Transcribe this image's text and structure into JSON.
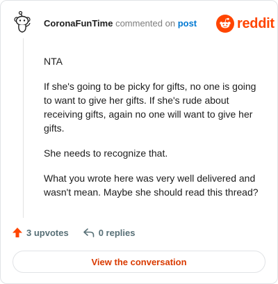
{
  "comment": {
    "author": "CoronaFunTime",
    "action_text": "commented on",
    "post_link_text": "post",
    "paragraphs": [
      "NTA",
      "If she's going to be picky for gifts, no one is going to want to give her gifts. If she's rude about receiving gifts, again no one will want to give her gifts.",
      "She needs to recognize that.",
      "What you wrote here was very well delivered and wasn't mean. Maybe she should read this thread?"
    ],
    "upvotes_text": "3 upvotes",
    "replies_text": "0 replies"
  },
  "brand": {
    "name": "reddit",
    "color": "#ff4500",
    "logo_icon": "reddit-snoo-icon"
  },
  "cta": {
    "label": "View the conversation",
    "color": "#d93a00"
  },
  "colors": {
    "upvote": "#ff4500",
    "link": "#0079d3",
    "muted": "#576f76"
  }
}
